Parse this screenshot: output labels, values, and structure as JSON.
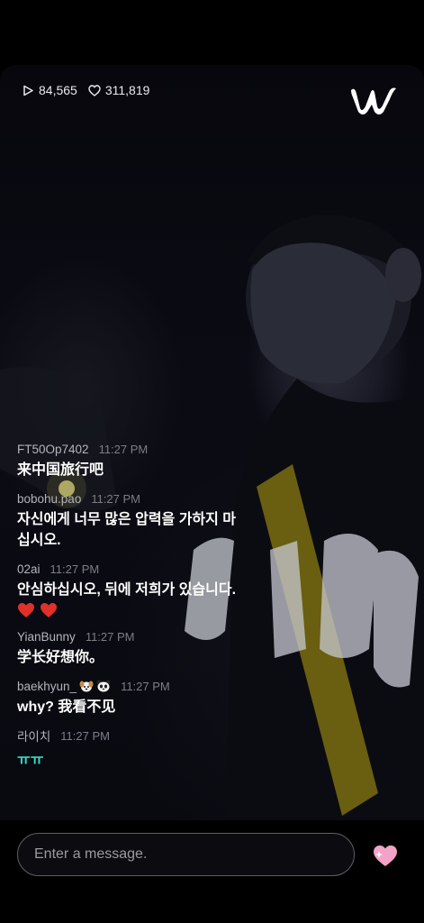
{
  "stats": {
    "views": "84,565",
    "likes": "311,819"
  },
  "brand": {
    "logo": "W"
  },
  "chat": [
    {
      "user": "FT50Op7402",
      "time": "11:27 PM",
      "text": "来中国旅行吧"
    },
    {
      "user": "bobohu.pao",
      "time": "11:27 PM",
      "text": "자신에게 너무 많은 압력을 가하지 마\n십시오."
    },
    {
      "user": "02ai",
      "time": "11:27 PM",
      "text": "안심하십시오, 뒤에 저희가 있습니다.",
      "hearts": "❤️❤️"
    },
    {
      "user": "YianBunny",
      "time": "11:27 PM",
      "text": "学长好想你。"
    },
    {
      "user": "baekhyun_",
      "user_emoji": [
        "puppy-emoji",
        "panda-emoji"
      ],
      "time": "11:27 PM",
      "text": "why? 我看不见"
    },
    {
      "user": "라이치",
      "time": "11:27 PM",
      "text": "ㅠㅠ"
    }
  ],
  "input": {
    "placeholder": "Enter a message."
  },
  "colors": {
    "accent_teal": "#37d8c6",
    "heart_pink": "#f4a3c8",
    "heart_red": "#e0302a"
  }
}
